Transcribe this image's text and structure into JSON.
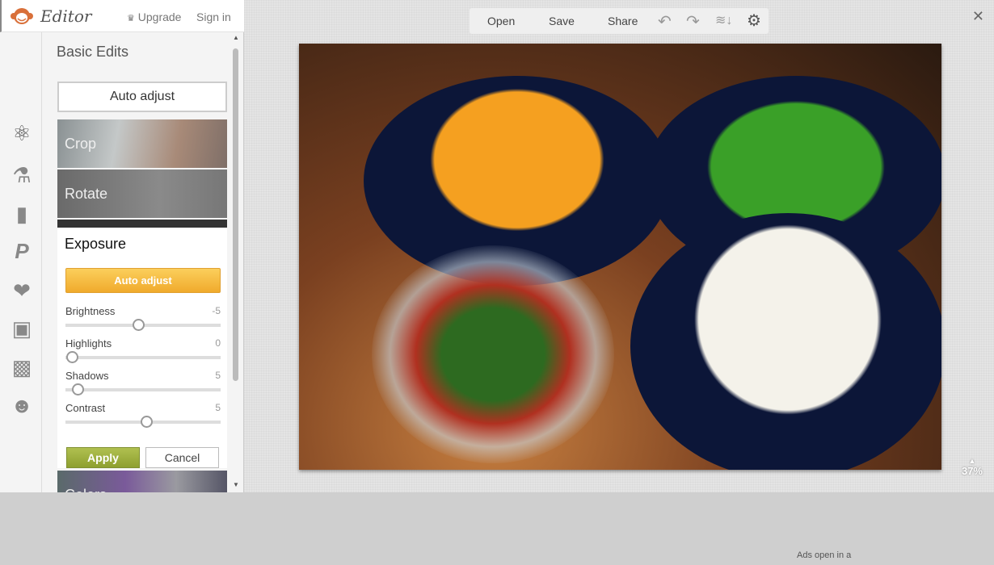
{
  "header": {
    "logo_text": "Editor",
    "upgrade": "Upgrade",
    "sign_in": "Sign in"
  },
  "tools": [
    "basic-edits",
    "effects",
    "touch-up",
    "text",
    "overlays",
    "frames",
    "textures",
    "seasonal"
  ],
  "panel": {
    "title": "Basic Edits",
    "auto_adjust": "Auto adjust",
    "cards": {
      "crop": "Crop",
      "rotate": "Rotate",
      "colors": "Colors"
    },
    "exposure": {
      "title": "Exposure",
      "auto_adjust": "Auto adjust",
      "sliders": [
        {
          "label": "Brightness",
          "value": "-5",
          "fraction": 0.47
        },
        {
          "label": "Highlights",
          "value": "0",
          "fraction": 0.04
        },
        {
          "label": "Shadows",
          "value": "5",
          "fraction": 0.08
        },
        {
          "label": "Contrast",
          "value": "5",
          "fraction": 0.52
        }
      ],
      "apply": "Apply",
      "cancel": "Cancel"
    }
  },
  "toolbar": {
    "open": "Open",
    "save": "Save",
    "share": "Share"
  },
  "zoom_level": "37%",
  "ads_note": "Ads open in a",
  "colors": {
    "accent_yellow": "#f0aa2c",
    "apply_green": "#8ea030"
  }
}
